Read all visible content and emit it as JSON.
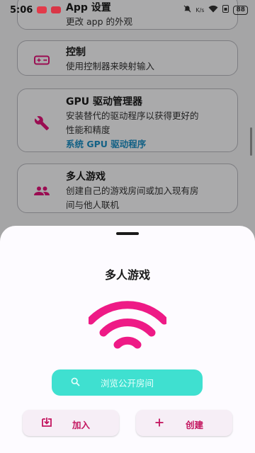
{
  "status_bar": {
    "time": "5:06",
    "battery": "88",
    "signal_text": "K/s"
  },
  "settings_list": {
    "app_settings": {
      "title": "App 设置",
      "desc": "更改 app 的外观"
    },
    "controls": {
      "title": "控制",
      "desc": "使用控制器来映射输入"
    },
    "gpu_driver": {
      "title": "GPU 驱动管理器",
      "desc_line1": "安装替代的驱动程序以获得更好的",
      "desc_line2": "性能和精度",
      "link": "系统 GPU 驱动程序"
    },
    "multiplayer": {
      "title": "多人游戏",
      "desc_line1": "创建自己的游戏房间或加入现有房",
      "desc_line2": "间与他人联机"
    }
  },
  "sheet": {
    "title": "多人游戏",
    "browse_label": "浏览公开房间",
    "join_label": "加入",
    "create_label": "创建"
  },
  "colors": {
    "accent": "#e4147a",
    "teal": "#3fe0d0",
    "link": "#1c8fc4"
  },
  "icons": {
    "controls": "gamepad-icon",
    "gpu": "wrench-icon",
    "multiplayer": "people-icon",
    "sheet": "wifi-icon",
    "browse": "search-icon",
    "join": "join-icon",
    "create": "plus-icon"
  }
}
